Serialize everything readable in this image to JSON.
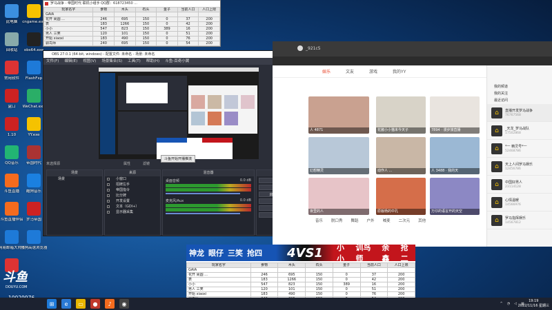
{
  "desktop_icons": [
    {
      "label": "此电脑",
      "icon": "computer-icon",
      "color": "#3b8fe0"
    },
    {
      "label": "cngame.exe",
      "icon": "pacman-icon",
      "color": "#f5c200"
    },
    {
      "label": "回收站",
      "icon": "recycle-bin-icon",
      "color": "#8aa"
    },
    {
      "label": "obs64.exe",
      "icon": "obs-icon",
      "color": "#222"
    },
    {
      "label": "常用软件",
      "icon": "app-icon",
      "color": "#d33"
    },
    {
      "label": "FlashFxp",
      "icon": "flash-icon",
      "color": "#1e7ad8"
    },
    {
      "label": "盒口",
      "icon": "app-icon",
      "color": "#c22"
    },
    {
      "label": "WeChat.exe",
      "icon": "wechat-icon",
      "color": "#2aae67"
    },
    {
      "label": "1.10",
      "icon": "app-icon",
      "color": "#c22"
    },
    {
      "label": "YY.exe",
      "icon": "yy-icon",
      "color": "#f5c200"
    },
    {
      "label": "QQ音乐",
      "icon": "qq-music-icon",
      "color": "#22b573"
    },
    {
      "label": "帝国时代",
      "icon": "game-icon",
      "color": "#a33"
    },
    {
      "label": "斗鱼直播",
      "icon": "douyu-icon",
      "color": "#f46b1e"
    },
    {
      "label": "酷狗音乐",
      "icon": "kugou-icon",
      "color": "#1b80e0"
    },
    {
      "label": "斗鱼直播伴侣",
      "icon": "douyu-icon",
      "color": "#f46b1e"
    },
    {
      "label": "罗马帝国",
      "icon": "game-icon",
      "color": "#c22"
    },
    {
      "label": "网易邮箱大师 5.0",
      "icon": "mail-icon",
      "color": "#1e7ad8"
    },
    {
      "label": "搜狗高速浏览器",
      "icon": "browser-icon",
      "color": "#1e7ad8"
    },
    {
      "label": "",
      "icon": "app-icon",
      "color": "#d33"
    }
  ],
  "score_window": {
    "title": "罗马战争 - 帝国时代 联机小组手 QQ群：618723450 ...",
    "headers": [
      "玩家名字",
      "食物",
      "木头",
      "石头",
      "金子",
      "当前人口",
      "人口上限"
    ],
    "rows": [
      [
        "GAIA",
        "",
        "",
        "",
        "",
        "",
        ""
      ],
      [
        "  花开 尚圆 ...",
        "246",
        "695",
        "150",
        "0",
        "37",
        "200"
      ],
      [
        "  表",
        "183",
        "1266",
        "150",
        "0",
        "42",
        "200"
      ],
      [
        "  小小",
        "547",
        "823",
        "150",
        "389",
        "16",
        "200"
      ],
      [
        "  男人 三笑",
        "120",
        "101",
        "150",
        "0",
        "51",
        "200"
      ],
      [
        "  开始 xiaoxi",
        "183",
        "490",
        "150",
        "0",
        "76",
        "200"
      ],
      [
        "  驯鸟师",
        "240",
        "695",
        "150",
        "0",
        "54",
        "200"
      ]
    ]
  },
  "obs": {
    "title": "OBS 27.0.1 (64-bit, windows) - 配置文件: 未命名 - 场景: 未命名",
    "menu": [
      "文件(F)",
      "编辑(E)",
      "视图(V)",
      "场景集合(S)",
      "工具(T)",
      "帮助(H)",
      "斗鱼-百奇小翼"
    ],
    "tooltip": "斗鱼开始开播推流",
    "scene_label": "未选择源",
    "properties_label": "属性",
    "filters_label": "滤镜",
    "panels": {
      "scenes": "场景",
      "sources": "来源",
      "mixer": "混音器",
      "controls": "控件"
    },
    "scenes": [
      "场景"
    ],
    "sources": [
      "小窗口",
      "招牌左手",
      "帝国指令",
      "比分牌",
      "开发设置",
      "文本（GDI+）",
      "显示器采集"
    ],
    "mixer": [
      {
        "name": "桌面音频",
        "level": "0.0 dB"
      },
      {
        "name": "麦克风/Aux",
        "level": "0.0 dB"
      }
    ],
    "controls": [
      "停止推流",
      "开始录制",
      "启动虚拟摄像机",
      "工作室模式",
      "设置",
      "退出"
    ]
  },
  "app": {
    "room_id": "_921c5",
    "nav": [
      "娱乐",
      "文友",
      "游戏",
      "我的YY"
    ],
    "nav_active": "娱乐",
    "tiles": [
      {
        "caption": "人 4871",
        "color": "#c9a190"
      },
      {
        "caption": "花酱小小猫未今天子",
        "color": "#d8d3c8"
      },
      {
        "caption": "7894 · 漫步旅直播",
        "color": "#e9e4df"
      },
      {
        "caption": "幻想精灵",
        "color": "#b8c8d8"
      },
      {
        "caption": "动作人 ...",
        "color": "#c9b7a6"
      },
      {
        "caption": "人 3488 · 我的天",
        "color": "#9bb8d4"
      },
      {
        "caption": "夜里的人",
        "color": "#e7c4c8"
      },
      {
        "caption": "原版杨的中孔",
        "color": "#d56e4a"
      },
      {
        "caption": "万仔的语言开的天空",
        "color": "#8c88c4"
      }
    ],
    "tags": [
      "音乐",
      "脱口秀",
      "舞蹈",
      "户外",
      "喊麦",
      "二次元",
      "其他"
    ],
    "sidebar_links": [
      "我的频道",
      "我的关注",
      "最近访问"
    ],
    "recent": [
      {
        "title": "直播开发罗马战争",
        "sub": "76767568",
        "badge": "FIRE"
      },
      {
        "title": "_天龙_罗马战队",
        "sub": "17502868"
      },
      {
        "title": "*一 精灵号*一",
        "sub": "52468786"
      },
      {
        "title": "天上人间罗马娱乐",
        "sub": "12456786"
      },
      {
        "title": "中国好男人",
        "sub": "23114128"
      },
      {
        "title": "心情温暖",
        "sub": "14566976"
      },
      {
        "title": "罗马指挥娱乐",
        "sub": "14567812"
      }
    ]
  },
  "overlay": {
    "left_names": [
      "神龙",
      "眼仔",
      "三笑",
      "抢四"
    ],
    "vs": "4VS1",
    "right_names": [
      "小小",
      "训鸟师",
      "余鑫",
      "抢二"
    ]
  },
  "watermark": {
    "brand": "斗鱼",
    "sub": "DOUYU.COM",
    "room": "10029976"
  },
  "taskbar": {
    "time": "19:19",
    "date": "2022/11/16 星期三",
    "tray_text": "英"
  }
}
